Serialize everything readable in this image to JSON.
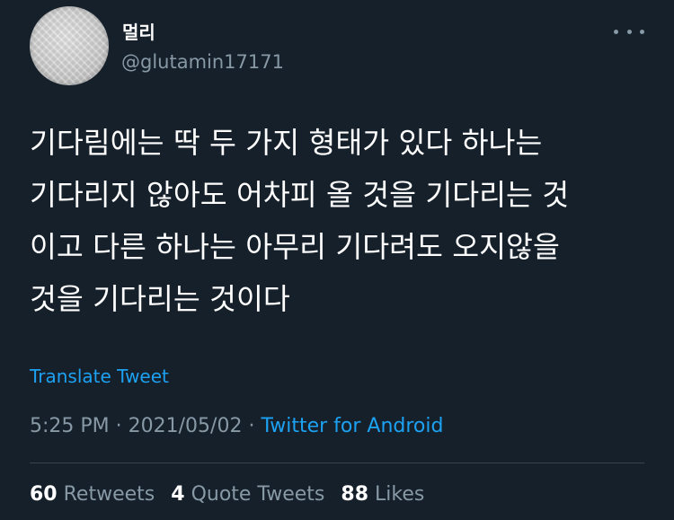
{
  "author": {
    "display_name": "멀리",
    "handle": "@glutamin17171"
  },
  "tweet": {
    "text": "기다림에는 딱 두 가지 형태가 있다 하나는\n기다리지 않아도 어차피 올 것을 기다리는 것\n이고 다른 하나는 아무리 기다려도 오지않을\n것을 기다리는 것이다",
    "translate_label": "Translate Tweet"
  },
  "meta": {
    "time": "5:25 PM",
    "separator": " · ",
    "date": "2021/05/02",
    "separator2": " · ",
    "source": "Twitter for Android"
  },
  "stats": {
    "retweets_count": "60",
    "retweets_label": "Retweets",
    "quotes_count": "4",
    "quotes_label": "Quote Tweets",
    "likes_count": "88",
    "likes_label": "Likes"
  },
  "colors": {
    "background": "#15202b",
    "text": "#ffffff",
    "secondary_text": "#8899a6",
    "accent": "#1da1f2",
    "divider": "#38444d"
  },
  "icons": {
    "more": "more-horizontal-icon"
  }
}
